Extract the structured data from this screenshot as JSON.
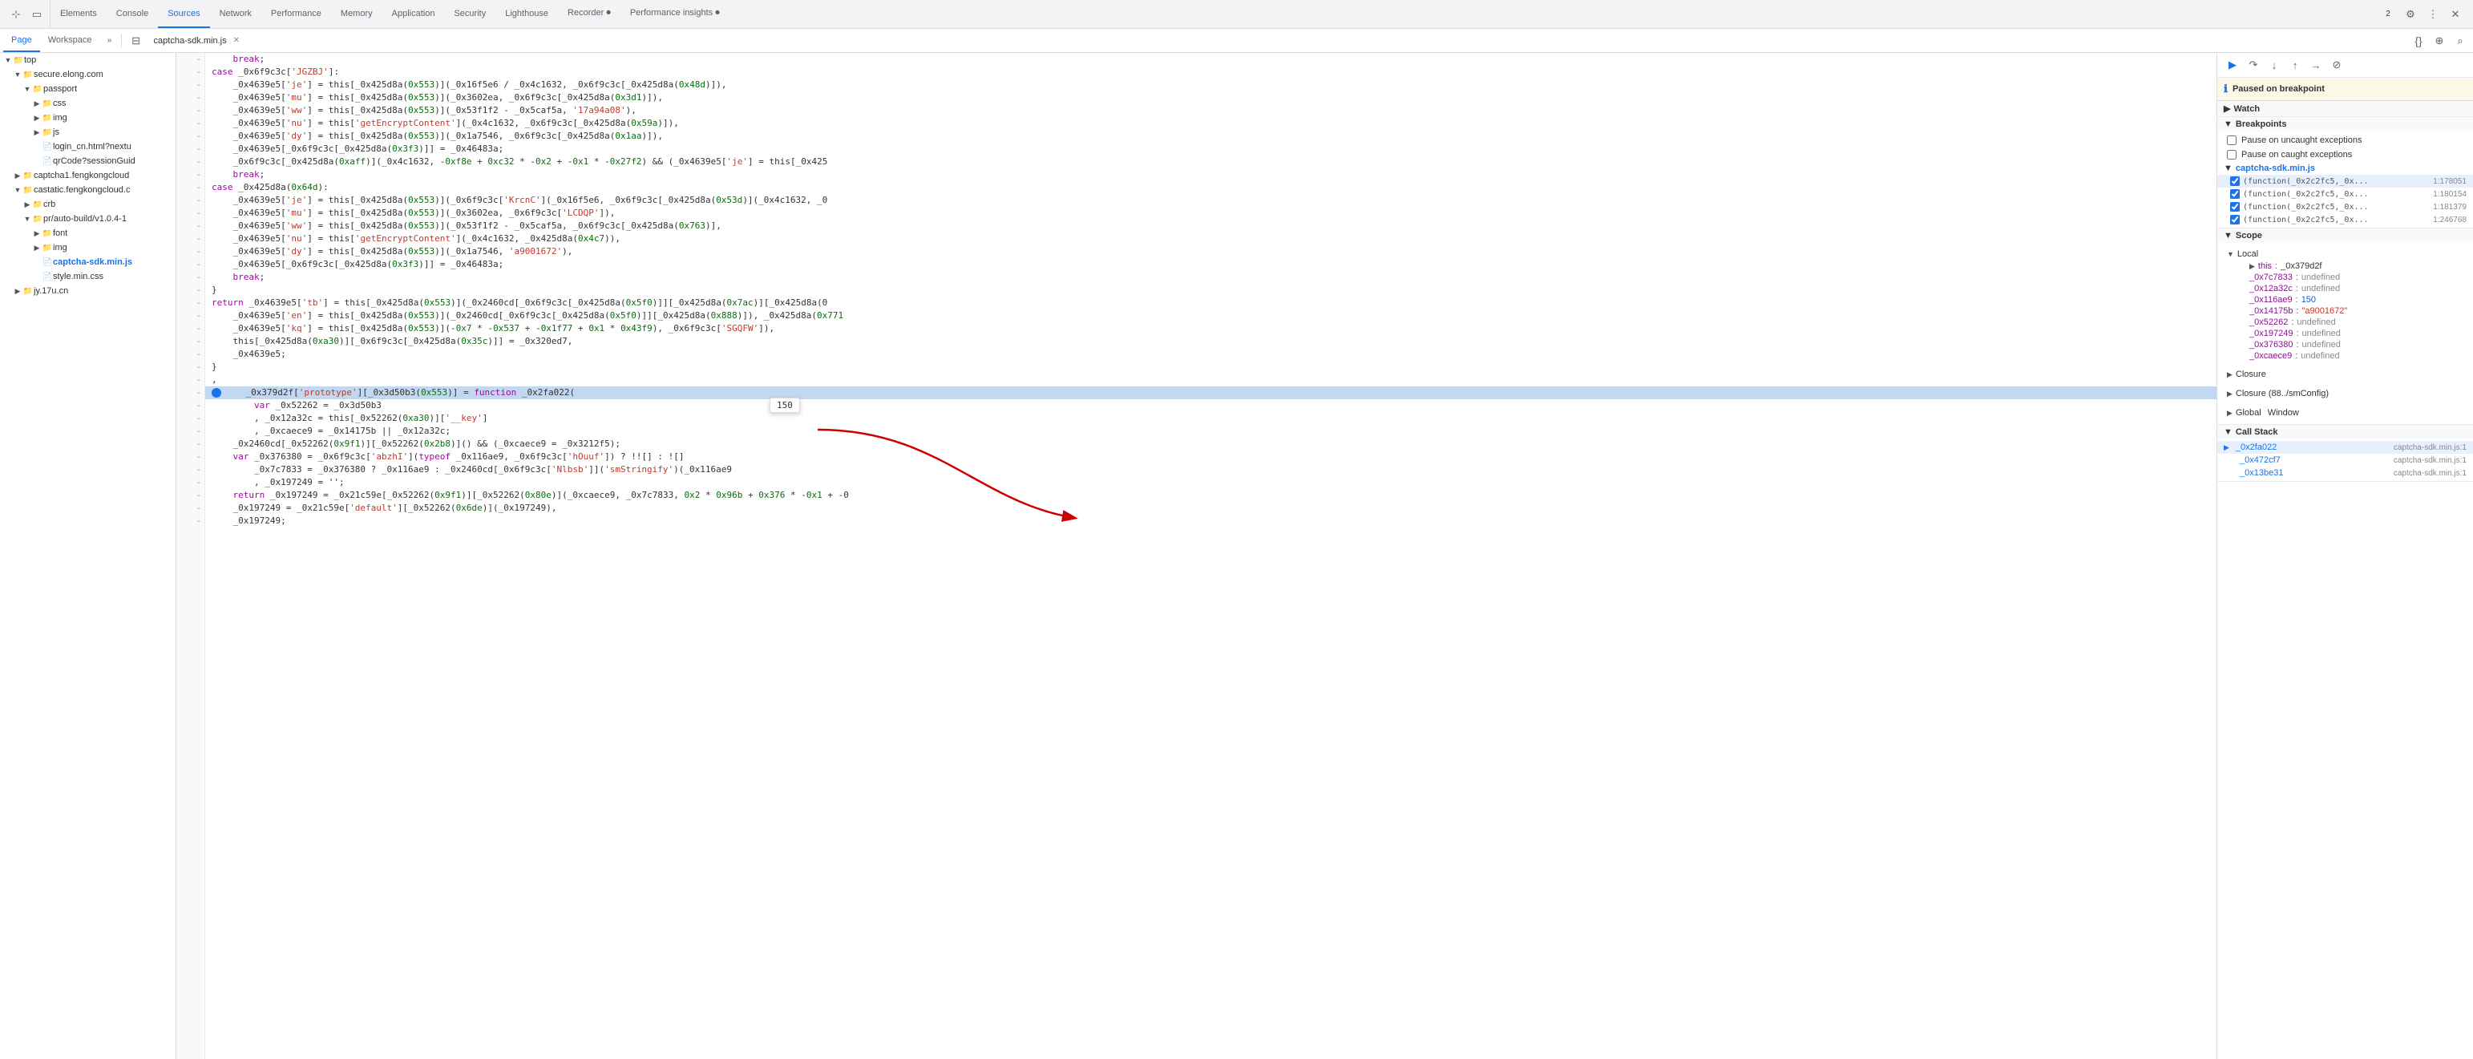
{
  "tabs": [
    {
      "label": "Elements",
      "active": false
    },
    {
      "label": "Console",
      "active": false
    },
    {
      "label": "Sources",
      "active": true
    },
    {
      "label": "Network",
      "active": false
    },
    {
      "label": "Performance",
      "active": false
    },
    {
      "label": "Memory",
      "active": false
    },
    {
      "label": "Application",
      "active": false
    },
    {
      "label": "Security",
      "active": false
    },
    {
      "label": "Lighthouse",
      "active": false
    },
    {
      "label": "Recorder ⏺",
      "active": false
    },
    {
      "label": "Performance insights ⏺",
      "active": false
    }
  ],
  "subtabs": [
    {
      "label": "Page",
      "active": true
    },
    {
      "label": "Workspace",
      "active": false
    }
  ],
  "active_file": "captcha-sdk.min.js",
  "sidebar": {
    "items": [
      {
        "label": "top",
        "level": 0,
        "type": "folder",
        "expanded": true
      },
      {
        "label": "secure.elong.com",
        "level": 1,
        "type": "domain",
        "expanded": true
      },
      {
        "label": "passport",
        "level": 2,
        "type": "folder",
        "expanded": true
      },
      {
        "label": "css",
        "level": 3,
        "type": "folder",
        "expanded": false
      },
      {
        "label": "img",
        "level": 3,
        "type": "folder",
        "expanded": false
      },
      {
        "label": "js",
        "level": 3,
        "type": "folder",
        "expanded": false
      },
      {
        "label": "login_cn.html?nextu",
        "level": 3,
        "type": "html"
      },
      {
        "label": "qrCode?sessionGuid",
        "level": 3,
        "type": "file"
      },
      {
        "label": "captcha1.fengkongcloud",
        "level": 1,
        "type": "domain",
        "expanded": false
      },
      {
        "label": "castatic.fengkongcloud.c",
        "level": 1,
        "type": "domain",
        "expanded": true
      },
      {
        "label": "crb",
        "level": 2,
        "type": "folder",
        "expanded": false
      },
      {
        "label": "pr/auto-build/v1.0.4-1",
        "level": 2,
        "type": "folder",
        "expanded": true
      },
      {
        "label": "font",
        "level": 3,
        "type": "folder",
        "expanded": false
      },
      {
        "label": "img",
        "level": 3,
        "type": "folder",
        "expanded": false
      },
      {
        "label": "captcha-sdk.min.js",
        "level": 3,
        "type": "js"
      },
      {
        "label": "style.min.css",
        "level": 3,
        "type": "css"
      },
      {
        "label": "jy.17u.cn",
        "level": 1,
        "type": "domain",
        "expanded": false
      }
    ]
  },
  "right_panel": {
    "paused_label": "Paused on breakpoint",
    "watch_label": "Watch",
    "breakpoints_label": "Breakpoints",
    "pause_uncaught": "Pause on uncaught exceptions",
    "pause_caught": "Pause on caught exceptions",
    "bp_file": "captcha-sdk.min.js",
    "breakpoints": [
      {
        "text": "(function(_0x2c2fc5,_0x...",
        "line": "1:178051",
        "active": true,
        "checked": true
      },
      {
        "text": "(function(_0x2c2fc5,_0x...",
        "line": "1:180154",
        "checked": true
      },
      {
        "text": "(function(_0x2c2fc5,_0x...",
        "line": "1:181379",
        "checked": true
      },
      {
        "text": "(function(_0x2c2fc5,_0x...",
        "line": "1:246768",
        "checked": true
      }
    ],
    "scope_label": "Scope",
    "local_label": "Local",
    "this_val": "_0x379d2f",
    "scope_vars": [
      {
        "name": "_0x7c7833",
        "val": "undefined"
      },
      {
        "name": "_0x12a32c",
        "val": "undefined"
      },
      {
        "name": "_0x116ae9",
        "val": "150"
      },
      {
        "name": "_0x14175b",
        "val": "\"a9001672\""
      },
      {
        "name": "_0x52262",
        "val": "undefined"
      },
      {
        "name": "_0x197249",
        "val": "undefined"
      },
      {
        "name": "_0x376380",
        "val": "undefined"
      },
      {
        "name": "_0xcaece9",
        "val": "undefined"
      }
    ],
    "closure_label": "Closure",
    "closure2_label": "Closure (88../smConfig)",
    "global_label": "Global",
    "global_val": "Window",
    "callstack_label": "Call Stack",
    "callstack": [
      {
        "name": "_0x2fa022",
        "file": "captcha-sdk.min.js:1",
        "active": true
      },
      {
        "name": "_0x472cf7",
        "file": "captcha-sdk.min.js:1"
      },
      {
        "name": "_0x13be31",
        "file": "captcha-sdk.min.js:1"
      }
    ]
  },
  "tooltip": "150",
  "code_lines": [
    {
      "num": "",
      "text": "    break;"
    },
    {
      "num": "",
      "text": "case _0x6f9c3c['JGZBJ']:"
    },
    {
      "num": "",
      "text": "    _0x4639e5['je'] = this[_0x425d8a(0x553)](_0x16f5e6 / _0x4c1632, _0x6f9c3c[_0x425d8a(0x48d)]),"
    },
    {
      "num": "",
      "text": "    _0x4639e5['mu'] = this[_0x425d8a(0x553)](_0x3602ea, _0x6f9c3c[_0x425d8a(0x3d1)]),"
    },
    {
      "num": "",
      "text": "    _0x4639e5['ww'] = this[_0x425d8a(0x553)](_0x53f1f2 - _0x5caf5a, '17a94a08'),"
    },
    {
      "num": "",
      "text": "    _0x4639e5['nu'] = this['getEncryptContent'](_0x4c1632, _0x6f9c3c[_0x425d8a(0x59a)]),"
    },
    {
      "num": "",
      "text": "    _0x4639e5['dy'] = this[_0x425d8a(0x553)](_0x1a7546, _0x6f9c3c[_0x425d8a(0x1aa)]),"
    },
    {
      "num": "",
      "text": "    _0x4639e5[_0x6f9c3c[_0x425d8a(0x3f3)]] = _0x46483a;"
    },
    {
      "num": "",
      "text": "    _0x6f9c3c[_0x425d8a(0xaff)](_0x4c1632, -0xf8e + 0xc32 * -0x2 + -0x1 * -0x27f2) && (_0x4639e5['je'] = this[_0x425"
    },
    {
      "num": "",
      "text": "    break;"
    },
    {
      "num": "",
      "text": "case _0x425d8a(0x64d):"
    },
    {
      "num": "",
      "text": "    _0x4639e5['je'] = this[_0x425d8a(0x553)](_0x6f9c3c['KrcnC'](_0x16f5e6, _0x6f9c3c[_0x425d8a(0x53d)](_0x4c1632, _0"
    },
    {
      "num": "",
      "text": "    _0x4639e5['mu'] = this[_0x425d8a(0x553)](_0x3602ea, _0x6f9c3c['LCDQP']),"
    },
    {
      "num": "",
      "text": "    _0x4639e5['ww'] = this[_0x425d8a(0x553)](_0x53f1f2 - _0x5caf5a, _0x6f9c3c[_0x425d8a(0x763)],"
    },
    {
      "num": "",
      "text": "    _0x4639e5['nu'] = this['getEncryptContent'](_0x4c1632, _0x425d8a(0x4c7)),"
    },
    {
      "num": "",
      "text": "    _0x4639e5['dy'] = this[_0x425d8a(0x553)](_0x1a7546, 'a9001672'),"
    },
    {
      "num": "",
      "text": "    _0x4639e5[_0x6f9c3c[_0x425d8a(0x3f3)]] = _0x46483a;"
    },
    {
      "num": "",
      "text": "    break;"
    },
    {
      "num": "",
      "text": "}"
    },
    {
      "num": "",
      "text": "return _0x4639e5['tb'] = this[_0x425d8a(0x553)](_0x2460cd[_0x6f9c3c[_0x425d8a(0x5f0)]][_0x425d8a(0x7ac)][_0x425d8a(0"
    },
    {
      "num": "",
      "text": "    _0x4639e5['en'] = this[_0x425d8a(0x553)](_0x2460cd[_0x6f9c3c[_0x425d8a(0x5f0)]][_0x425d8a(0x888)]), _0x425d8a(0x771"
    },
    {
      "num": "",
      "text": "    _0x4639e5['kq'] = this[_0x425d8a(0x553)](-0x7 * -0x537 + -0x1f77 + 0x1 * 0x43f9), _0x6f9c3c['SGQFW']),"
    },
    {
      "num": "",
      "text": "    this[_0x425d8a(0xa30)][_0x6f9c3c[_0x425d8a(0x35c)]] = _0x320ed7,"
    },
    {
      "num": "",
      "text": "    _0x4639e5;"
    },
    {
      "num": "",
      "text": "}"
    },
    {
      "num": "",
      "text": ","
    },
    {
      "num": "",
      "highlighted": true,
      "text": "    _0x379d2f['prototype'][_0x3d50b3(0x553)] = function _0x2fa022("
    },
    {
      "num": "",
      "text": "        var _0x52262 = _0x3d50b3"
    },
    {
      "num": "",
      "text": "        , _0x12a32c = this[_0x52262(0xa30)]['__key']"
    },
    {
      "num": "",
      "text": "        , _0xcaece9 = _0x14175b || _0x12a32c;"
    },
    {
      "num": "",
      "text": "    _0x2460cd[_0x52262(0x9f1)][_0x52262(0x2b8)]() && (_0xcaece9 = _0x3212f5);"
    },
    {
      "num": "",
      "text": "    var _0x376380 = _0x6f9c3c['abzhI'](typeof _0x116ae9, _0x6f9c3c['hOuuf']) ? !![] : ![]"
    },
    {
      "num": "",
      "text": "        _0x7c7833 = _0x376380 ? _0x116ae9 : _0x2460cd[_0x6f9c3c['Nlbsb']]('smStringify')(_0x116ae9"
    },
    {
      "num": "",
      "text": "        , _0x197249 = '';"
    },
    {
      "num": "",
      "text": "    return _0x197249 = _0x21c59e[_0x52262(0x9f1)][_0x52262(0x80e)](_0xcaece9, _0x7c7833, 0x2 * 0x96b + 0x376 * -0x1 + -0"
    },
    {
      "num": "",
      "text": "    _0x197249 = _0x21c59e['default'][_0x52262(0x6de)](_0x197249),"
    },
    {
      "num": "",
      "text": "    _0x197249;"
    }
  ]
}
